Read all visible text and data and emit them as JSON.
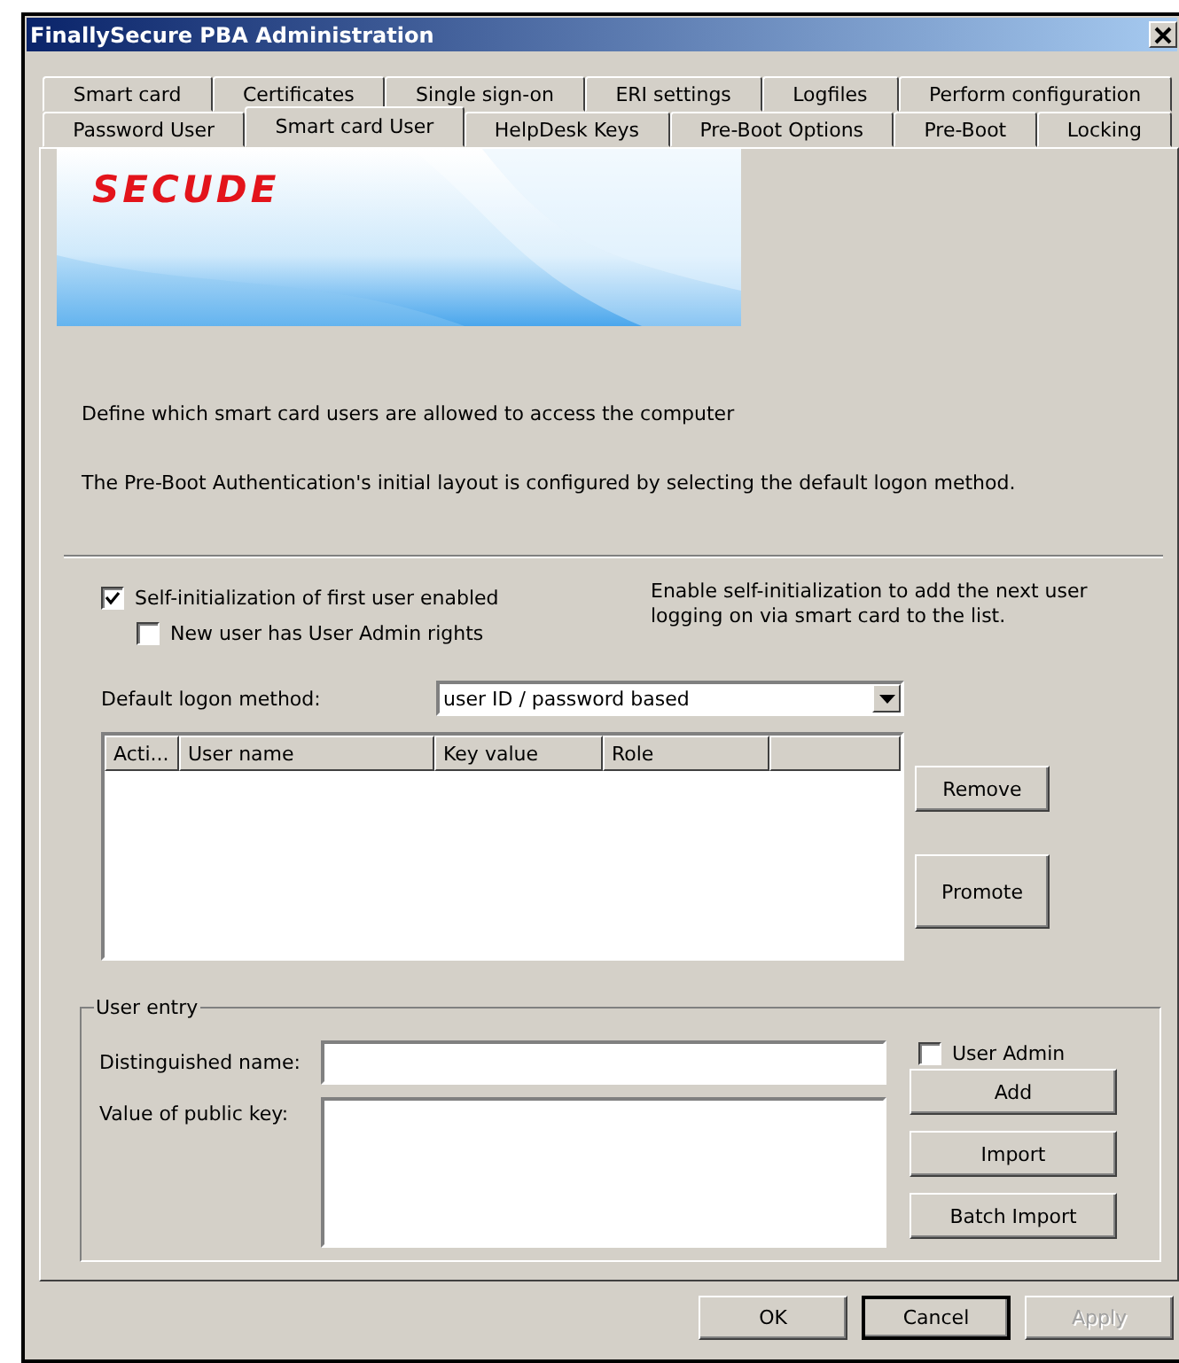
{
  "window": {
    "title": "FinallySecure PBA Administration"
  },
  "tab_rows": [
    [
      {
        "label": "Smart card",
        "selected": false
      },
      {
        "label": "Certificates",
        "selected": false
      },
      {
        "label": "Single sign-on",
        "selected": false
      },
      {
        "label": "ERI settings",
        "selected": false
      },
      {
        "label": "Logfiles",
        "selected": false
      },
      {
        "label": "Perform configuration",
        "selected": false
      }
    ],
    [
      {
        "label": "Password User",
        "selected": false
      },
      {
        "label": "Smart card User",
        "selected": true
      },
      {
        "label": "HelpDesk Keys",
        "selected": false
      },
      {
        "label": "Pre-Boot Options",
        "selected": false
      },
      {
        "label": "Pre-Boot",
        "selected": false
      },
      {
        "label": "Locking",
        "selected": false
      }
    ]
  ],
  "banner": {
    "logo": "SECUDE"
  },
  "descriptions": [
    "Define which smart card users are allowed to access the computer",
    "The Pre-Boot Authentication's initial layout is configured by selecting the default logon method."
  ],
  "self_init": {
    "label": "Self-initialization of first user enabled",
    "checked": true
  },
  "admin_rights": {
    "label": "New user has User Admin rights",
    "checked": false
  },
  "hint": "Enable self-initialization to add the next user logging on via smart card to the list.",
  "logon_method": {
    "label": "Default logon method:",
    "value": "user ID / password based"
  },
  "table": {
    "columns": [
      "Acti...",
      "User name",
      "Key value",
      "Role"
    ]
  },
  "list_buttons": [
    "Remove",
    "Promote"
  ],
  "user_entry": {
    "legend": "User entry",
    "dn_label": "Distinguished name:",
    "key_label": "Value of public key:",
    "user_admin": {
      "label": "User Admin",
      "checked": false
    },
    "buttons": [
      "Add",
      "Import",
      "Batch Import"
    ]
  },
  "footer_buttons": [
    {
      "label": "OK",
      "disabled": false,
      "default": false
    },
    {
      "label": "Cancel",
      "disabled": false,
      "default": true
    },
    {
      "label": "Apply",
      "disabled": true,
      "default": false
    }
  ]
}
